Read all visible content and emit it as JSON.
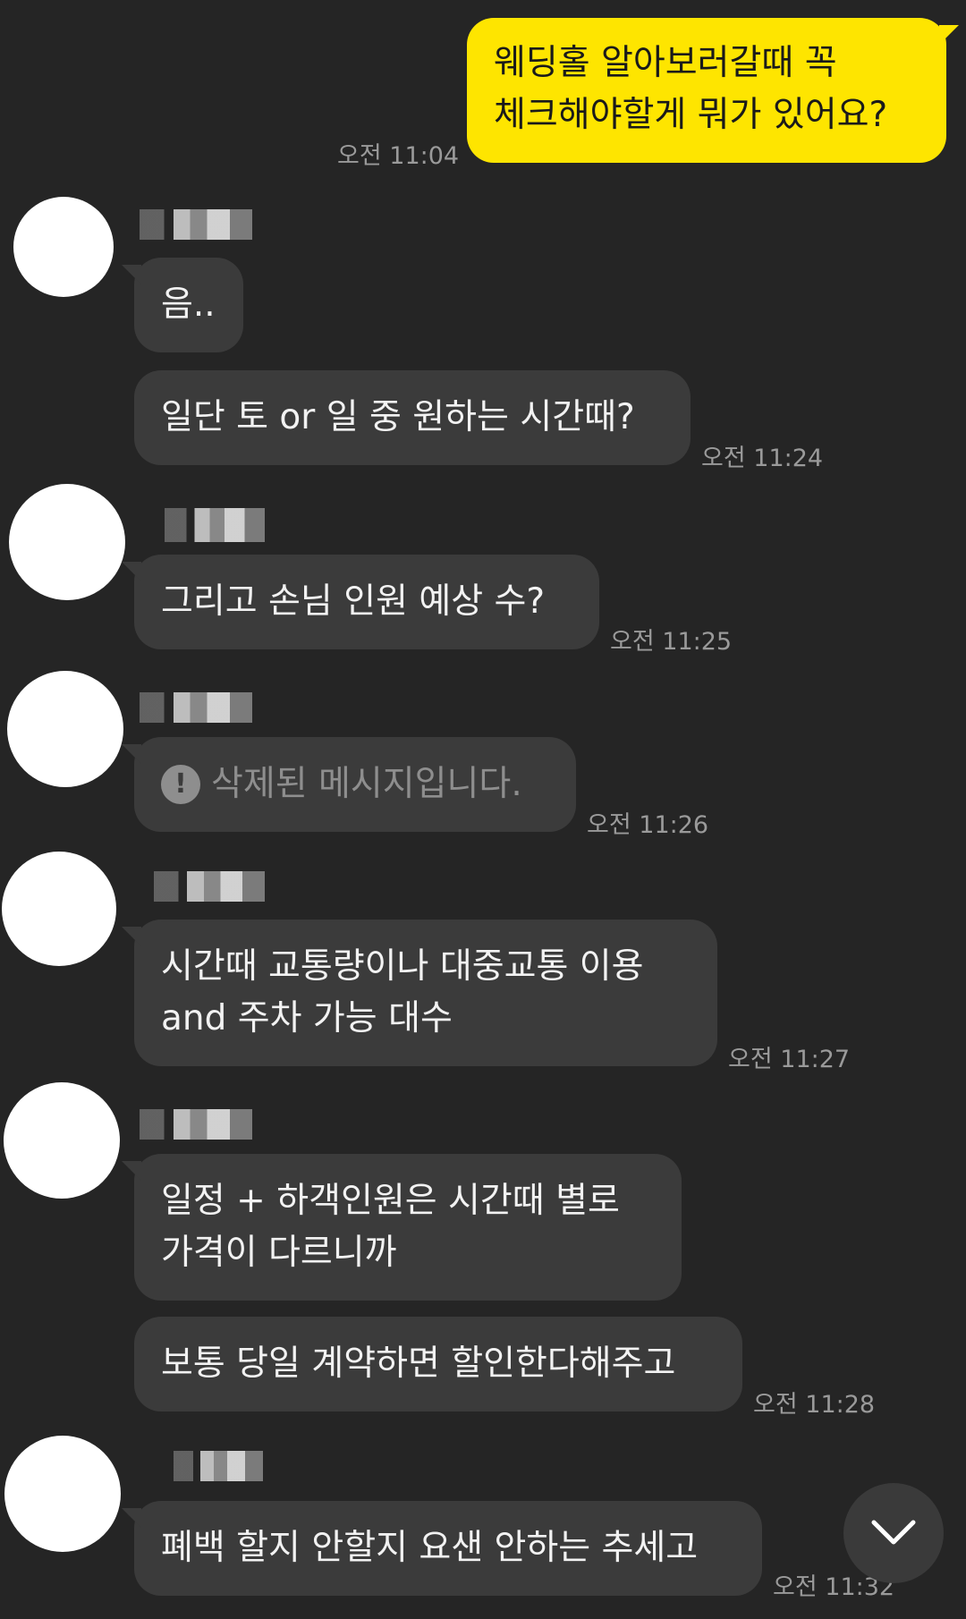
{
  "my_message": {
    "text": "웨딩홀 알아보러갈때 꼭\n체크해야할게 뭐가 있어요?",
    "time": "오전 11:04"
  },
  "messages": [
    {
      "text": "음.."
    },
    {
      "text": "일단 토 or 일 중 원하는 시간때?",
      "time": "오전 11:24"
    },
    {
      "text": "그리고 손님 인원 예상 수?",
      "time": "오전 11:25"
    },
    {
      "text": "삭제된 메시지입니다.",
      "time": "오전 11:26",
      "deleted_icon": "!"
    },
    {
      "text": "시간때 교통량이나 대중교통 이용\nand 주차 가능 대수",
      "time": "오전 11:27"
    },
    {
      "text": "일정 + 하객인원은 시간때 별로\n가격이 다르니까"
    },
    {
      "text": "보통 당일 계약하면 할인한다해주고",
      "time": "오전 11:28"
    },
    {
      "text": "폐백 할지 안할지 요샌 안하는 추세고",
      "time": "오전 11:32"
    }
  ],
  "scroll_icon": "chevron-down-icon"
}
